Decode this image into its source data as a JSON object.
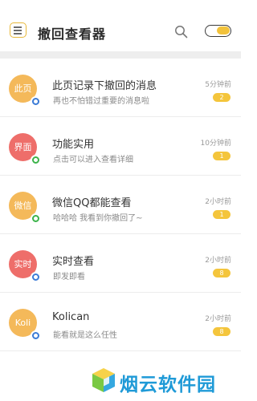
{
  "header": {
    "title": "撤回查看器",
    "menu_icon": "menu-icon",
    "search_icon": "search-icon",
    "toggle_state": "on",
    "accent_color": "#f2c23b"
  },
  "list": [
    {
      "avatar_text": "此页",
      "avatar_color": "#f4b95a",
      "badge": "blue",
      "name": "此页记录下撤回的消息",
      "sub": "再也不怕错过重要的消息啦",
      "time": "5分钟前",
      "count": "2"
    },
    {
      "avatar_text": "界面",
      "avatar_color": "#ee6e6a",
      "badge": "green",
      "name": "功能实用",
      "sub": "点击可以进入查看详细",
      "time": "10分钟前",
      "count": "1"
    },
    {
      "avatar_text": "微信",
      "avatar_color": "#f4b95a",
      "badge": "green",
      "name": "微信QQ都能查看",
      "sub": "哈哈哈 我看到你撤回了~",
      "time": "2小时前",
      "count": "1"
    },
    {
      "avatar_text": "实时",
      "avatar_color": "#ee6e6a",
      "badge": "blue",
      "name": "实时查看",
      "sub": "即发即看",
      "time": "2小时前",
      "count": "8"
    },
    {
      "avatar_text": "Koli",
      "avatar_color": "#f4b95a",
      "badge": "blue",
      "name": "Kolican",
      "sub": "能看就是这么任性",
      "time": "2小时前",
      "count": "8"
    }
  ],
  "watermark": {
    "text": "烟云软件园",
    "color": "#1f9ad7"
  }
}
